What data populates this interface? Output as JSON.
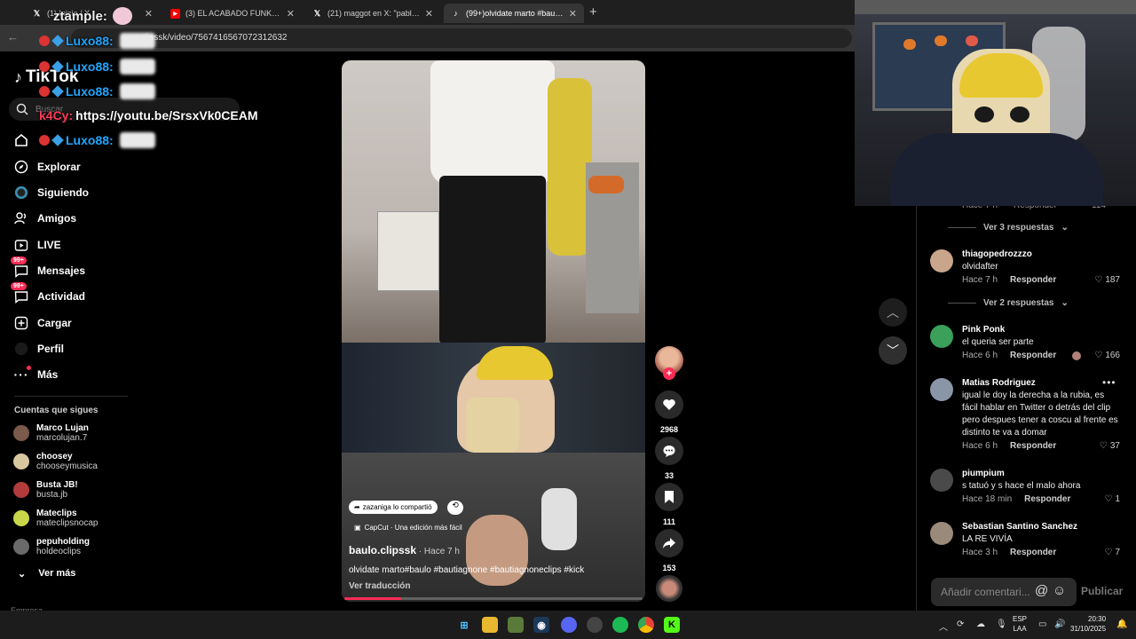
{
  "browser": {
    "tabs": [
      {
        "title": "(1) Inicio / X",
        "favicon": "x-logo-icon",
        "active": false
      },
      {
        "title": "(3) EL ACABADO FUNK - Launc",
        "favicon": "youtube-icon",
        "active": false
      },
      {
        "title": "(21) maggot en X: \"pabloxo es",
        "favicon": "x-logo-icon",
        "active": false
      },
      {
        "title": "(99+)olvidate marto #baulo #ba",
        "favicon": "tiktok-icon",
        "active": true
      }
    ],
    "url": "o.clipssk/video/7567416567072312632"
  },
  "chat_overlay": [
    {
      "user": "Luxo88:",
      "message": ""
    },
    {
      "user": "Luxo88:",
      "message": ""
    },
    {
      "user": "Luxo88:",
      "message": ""
    },
    {
      "user": "k4Cy:",
      "message": "https://youtu.be/SrsxVk0CEAM"
    },
    {
      "user": "Luxo88:",
      "message": ""
    }
  ],
  "chat_top": {
    "user": "ztample:"
  },
  "tiktok": {
    "logo": "TikTok",
    "search_placeholder": "Buscar",
    "nav": [
      {
        "label": "Explorar",
        "icon": "compass-icon"
      },
      {
        "label": "Siguiendo",
        "icon": "following-icon"
      },
      {
        "label": "Amigos",
        "icon": "friends-icon"
      },
      {
        "label": "LIVE",
        "icon": "live-icon"
      },
      {
        "label": "Mensajes",
        "icon": "messages-icon",
        "badge": "99+"
      },
      {
        "label": "Actividad",
        "icon": "activity-icon",
        "badge": "99+"
      },
      {
        "label": "Cargar",
        "icon": "upload-icon"
      },
      {
        "label": "Perfil",
        "icon": "profile-icon"
      },
      {
        "label": "Más",
        "icon": "more-icon"
      }
    ],
    "following_title": "Cuentas que sigues",
    "following": [
      {
        "name": "Marco Lujan",
        "handle": "marcolujan.7",
        "color": "#7a5a4a"
      },
      {
        "name": "choosey",
        "handle": "chooseymusica",
        "color": "#d9c7a0"
      },
      {
        "name": "Busta JB!",
        "handle": "busta.jb",
        "color": "#b23b3b"
      },
      {
        "name": "Mateclips",
        "handle": "mateclipsnocap",
        "color": "#c9d64a"
      },
      {
        "name": "pepuholding",
        "handle": "holdeoclips",
        "color": "#6a6a6a"
      }
    ],
    "see_more": "Ver más",
    "company": "Empresa"
  },
  "video": {
    "shared_by": "zazaniga lo compartió",
    "capcut": "CapCut · Una edición más fácil",
    "author": "baulo.clipssk",
    "ago": " · Hace 7 h",
    "caption": "olvidate marto#baulo #bautiagnone #bautiagnoneclips #kick",
    "translate": "Ver traducción",
    "progress": 0.19
  },
  "actions": {
    "likes": "2968",
    "comments": "33",
    "saves": "111",
    "shares": "153"
  },
  "comments": {
    "partial_meta": [
      "Hace 7 h",
      "Responder"
    ],
    "partial_likes": "114",
    "replies_1": "Ver 3 respuestas",
    "replies_2": "Ver 2 respuestas",
    "reply_label": "Responder",
    "items": [
      {
        "user": "thiagopedrozzzo",
        "text": "olvidafter",
        "time": "Hace 7 h",
        "likes": "187",
        "avatar": "#c9a58b"
      },
      {
        "user": "Pink Ponk",
        "text": "el queria ser parte",
        "time": "Hace 6 h",
        "likes": "166",
        "avatar": "#3aa05a"
      },
      {
        "user": "Matias Rodriguez",
        "text": "igual le doy la derecha a la rubia, es fácil hablar en Twitter o detrás del clip pero despues tener a coscu al frente es distinto te va a domar",
        "time": "Hace 6 h",
        "likes": "37",
        "avatar": "#8a96a8"
      },
      {
        "user": "piumpium",
        "text": "s tatuó y s hace el malo ahora",
        "time": "Hace 18 min",
        "likes": "1",
        "avatar": "#4a4a4a"
      },
      {
        "user": "Sebastian Santino Sanchez",
        "text": "LA RE VIVÍA",
        "time": "Hace 3 h",
        "likes": "7",
        "avatar": "#9a8a7a"
      }
    ],
    "add_placeholder": "Añadir comentari...",
    "publish": "Publicar"
  },
  "taskbar": {
    "lang_1": "ESP",
    "lang_2": "LAA",
    "time": "20:30",
    "date": "31/10/2025"
  }
}
